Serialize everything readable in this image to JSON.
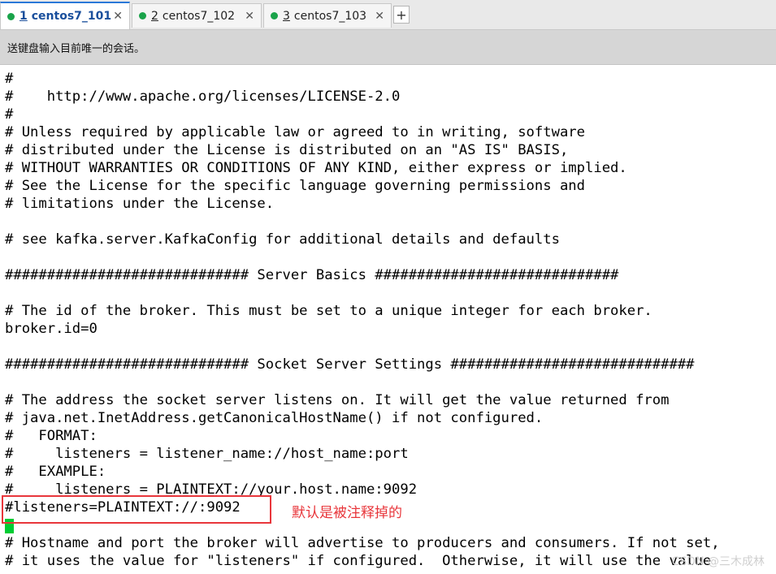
{
  "tabs": [
    {
      "num": "1",
      "label": "centos7_101",
      "dot_color": "#1aa34a",
      "active": true,
      "close": "✕"
    },
    {
      "num": "2",
      "label": "centos7_102",
      "dot_color": "#1aa34a",
      "active": false,
      "close": "✕"
    },
    {
      "num": "3",
      "label": "centos7_103",
      "dot_color": "#1aa34a",
      "active": false,
      "close": "✕"
    }
  ],
  "add_tab_label": "+",
  "hint_bar": "送键盘输入目前唯一的会话。",
  "terminal_lines": [
    "#",
    "#    http://www.apache.org/licenses/LICENSE-2.0",
    "#",
    "# Unless required by applicable law or agreed to in writing, software",
    "# distributed under the License is distributed on an \"AS IS\" BASIS,",
    "# WITHOUT WARRANTIES OR CONDITIONS OF ANY KIND, either express or implied.",
    "# See the License for the specific language governing permissions and",
    "# limitations under the License.",
    "",
    "# see kafka.server.KafkaConfig for additional details and defaults",
    "",
    "############################# Server Basics #############################",
    "",
    "# The id of the broker. This must be set to a unique integer for each broker.",
    "broker.id=0",
    "",
    "############################# Socket Server Settings #############################",
    "",
    "# The address the socket server listens on. It will get the value returned from",
    "# java.net.InetAddress.getCanonicalHostName() if not configured.",
    "#   FORMAT:",
    "#     listeners = listener_name://host_name:port",
    "#   EXAMPLE:",
    "#     listeners = PLAINTEXT://your.host.name:9092",
    "#listeners=PLAINTEXT://:9092",
    "",
    "# Hostname and port the broker will advertise to producers and consumers. If not set,",
    "# it uses the value for \"listeners\" if configured.  Otherwise, it will use the value"
  ],
  "annotation": "默认是被注释掉的",
  "watermark": "CSDN @三木成林",
  "colors": {
    "active_tab_accent": "#2b78d8",
    "cursor": "#00cc33",
    "annotation_red": "#e8363b"
  }
}
